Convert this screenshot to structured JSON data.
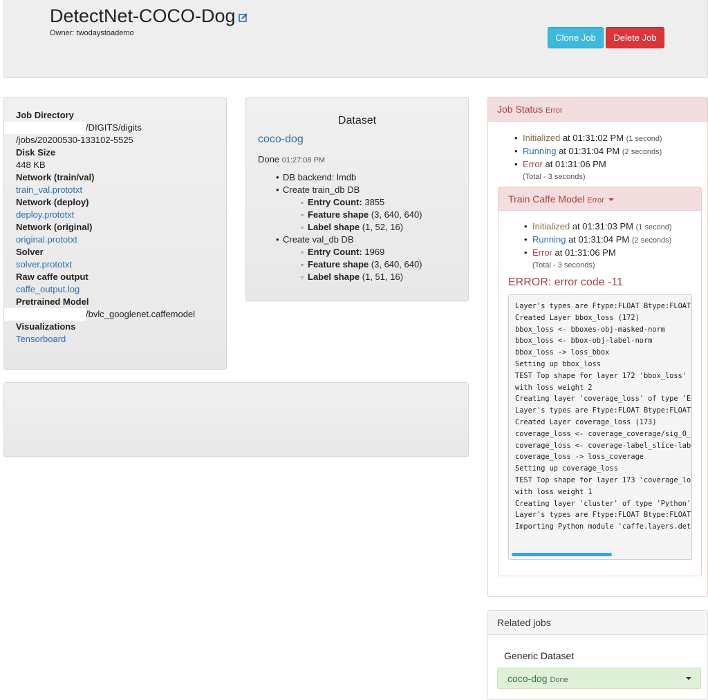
{
  "header": {
    "title": "DetectNet-COCO-Dog",
    "owner": "Owner: twodaystoademo",
    "clone_label": "Clone Job",
    "delete_label": "Delete Job"
  },
  "info": {
    "job_directory_label": "Job Directory",
    "job_directory_line1": "/DIGITS/digits",
    "job_directory_line2": "/jobs/20200530-133102-5525",
    "disk_size_label": "Disk Size",
    "disk_size_value": "448 KB",
    "network_trainval_label": "Network (train/val)",
    "network_trainval_link": "train_val.prototxt",
    "network_deploy_label": "Network (deploy)",
    "network_deploy_link": "deploy.prototxt",
    "network_original_label": "Network (original)",
    "network_original_link": "original.prototxt",
    "solver_label": "Solver",
    "solver_link": "solver.prototxt",
    "raw_output_label": "Raw caffe output",
    "raw_output_link": "caffe_output.log",
    "pretrained_label": "Pretrained Model",
    "pretrained_value": "/bvlc_googlenet.caffemodel",
    "visualizations_label": "Visualizations",
    "visualizations_link": "Tensorboard"
  },
  "dataset": {
    "heading": "Dataset",
    "name": "coco-dog",
    "done_label": "Done",
    "done_time": "01:27:08 PM",
    "backend": "DB backend: lmdb",
    "train_db": "Create train_db DB",
    "train_entry_label": "Entry Count:",
    "train_entry_value": "3855",
    "train_feature_label": "Feature shape",
    "train_feature_value": "(3, 640, 640)",
    "train_label_label": "Label shape",
    "train_label_value": "(1, 52, 16)",
    "val_db": "Create val_db DB",
    "val_entry_label": "Entry Count:",
    "val_entry_value": "1969",
    "val_feature_label": "Feature shape",
    "val_feature_value": "(3, 640, 640)",
    "val_label_label": "Label shape",
    "val_label_value": "(1, 51, 16)"
  },
  "job_status": {
    "title": "Job Status",
    "badge": "Error",
    "events": [
      {
        "state": "Initialized",
        "time": "at 01:31:02 PM",
        "duration": "(1 second)"
      },
      {
        "state": "Running",
        "time": "at 01:31:04 PM",
        "duration": "(2 seconds)"
      },
      {
        "state": "Error",
        "time": "at 01:31:06 PM",
        "duration": ""
      }
    ],
    "total": "(Total - 3 seconds)"
  },
  "train_model": {
    "title": "Train Caffe Model",
    "badge": "Error",
    "events": [
      {
        "state": "Initialized",
        "time": "at 01:31:03 PM",
        "duration": "(1 second)"
      },
      {
        "state": "Running",
        "time": "at 01:31:04 PM",
        "duration": "(2 seconds)"
      },
      {
        "state": "Error",
        "time": "at 01:31:06 PM",
        "duration": ""
      }
    ],
    "total": "(Total - 3 seconds)",
    "error_title": "ERROR: error code -11",
    "log": [
      "Layer's types are Ftype:FLOAT Btype:FLOAT",
      "Created Layer bbox_loss (172)",
      "bbox_loss <- bboxes-obj-masked-norm",
      "bbox_loss <- bbox-obj-label-norm",
      "bbox_loss -> loss_bbox",
      "Setting up bbox_loss",
      "TEST Top shape for layer 172 'bbox_loss'",
      "with loss weight 2",
      "Creating layer 'coverage_loss' of type 'E",
      "Layer's types are Ftype:FLOAT Btype:FLOAT",
      "Created Layer coverage_loss (173)",
      "coverage_loss <- coverage_coverage/sig_0_",
      "coverage_loss <- coverage-label_slice-lab",
      "coverage_loss -> loss_coverage",
      "Setting up coverage_loss",
      "TEST Top shape for layer 173 'coverage_lo",
      "with loss weight 1",
      "Creating layer 'cluster' of type 'Python'",
      "Layer's types are Ftype:FLOAT Btype:FLOAT",
      "Importing Python module 'caffe.layers.det"
    ]
  },
  "related": {
    "title": "Related jobs",
    "sub_title": "Generic Dataset",
    "item_name": "coco-dog",
    "item_badge": "Done"
  },
  "colors": {
    "clone_button": "#3fb8de",
    "delete_button": "#d9363a",
    "error_red": "#a94442",
    "link_blue": "#2a6fae",
    "initialized_amber": "#8a6d3b",
    "success_green_bg": "#dff0d8"
  }
}
